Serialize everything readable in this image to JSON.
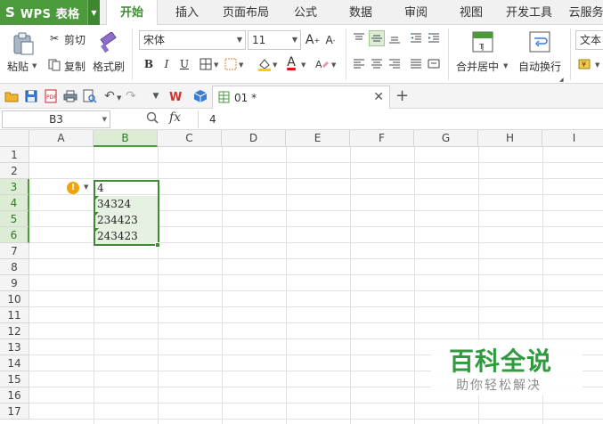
{
  "app": {
    "logo": "S",
    "title": "WPS 表格"
  },
  "menu_tabs": [
    "开始",
    "插入",
    "页面布局",
    "公式",
    "数据",
    "审阅",
    "视图",
    "开发工具",
    "云服务"
  ],
  "ribbon": {
    "paste": "粘贴",
    "cut": "剪切",
    "copy": "复制",
    "format_painter": "格式刷",
    "font_name": "宋体",
    "font_size": "11",
    "merge_center": "合并居中",
    "wrap_text": "自动换行",
    "number_format": "文本"
  },
  "document": {
    "tab_name": "01 *"
  },
  "formula_bar": {
    "name_box": "B3",
    "fx": "fx",
    "value": "4"
  },
  "grid": {
    "columns": [
      "A",
      "B",
      "C",
      "D",
      "E",
      "F",
      "G",
      "H",
      "I"
    ],
    "selected_column": "B",
    "rows": [
      "1",
      "2",
      "3",
      "4",
      "5",
      "6",
      "7",
      "8",
      "9",
      "10",
      "11",
      "12",
      "13",
      "14",
      "15",
      "16",
      "17"
    ],
    "selected_rows": [
      "3",
      "4",
      "5",
      "6"
    ],
    "cells": {
      "B3": "4",
      "B4": "34324",
      "B5": "234423",
      "B6": "243423"
    },
    "warning_icon": "!"
  },
  "watermark": {
    "title": "百科全说",
    "subtitle": "助你轻松解决"
  },
  "colors": {
    "accent": "#4c9a3c",
    "accent_dark": "#3d8a32",
    "warning": "#f0a30a",
    "watermark": "#2f9a3e"
  }
}
